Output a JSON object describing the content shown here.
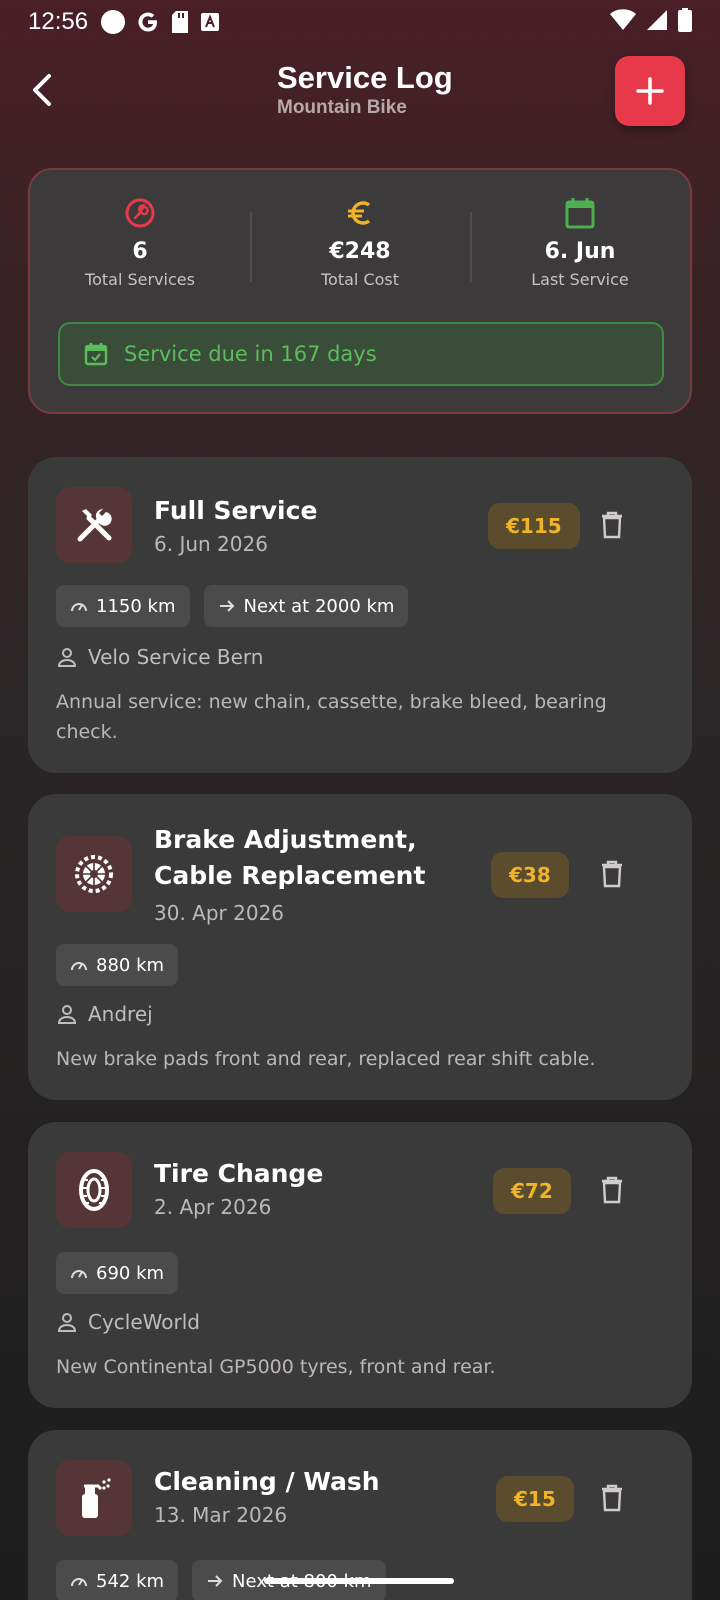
{
  "status_bar": {
    "time": "12:56"
  },
  "header": {
    "title": "Service Log",
    "subtitle": "Mountain Bike"
  },
  "summary": {
    "stats": [
      {
        "value": "6",
        "label": "Total Services",
        "icon": "wrench-icon",
        "color": "#e8394b"
      },
      {
        "value": "€248",
        "label": "Total Cost",
        "icon": "euro-icon",
        "color": "#f0b429"
      },
      {
        "value": "6. Jun",
        "label": "Last Service",
        "icon": "calendar-icon",
        "color": "#4caf50"
      }
    ],
    "due_text": "Service due in 167 days"
  },
  "services": [
    {
      "title": "Full Service",
      "date": "6. Jun 2026",
      "price": "€115",
      "icon": "tools-icon",
      "mileage": "1150 km",
      "next": "Next at 2000 km",
      "provider": "Velo Service Bern",
      "notes": "Annual service: new chain, cassette, brake bleed, bearing check."
    },
    {
      "title": "Brake Adjustment, Cable Replacement",
      "date": "30. Apr 2026",
      "price": "€38",
      "icon": "brake-disc-icon",
      "mileage": "880 km",
      "provider": "Andrej",
      "notes": "New brake pads front and rear, replaced rear shift cable."
    },
    {
      "title": "Tire Change",
      "date": "2. Apr 2026",
      "price": "€72",
      "icon": "tire-icon",
      "mileage": "690 km",
      "provider": "CycleWorld",
      "notes": "New Continental GP5000 tyres, front and rear."
    },
    {
      "title": "Cleaning / Wash",
      "date": "13. Mar 2026",
      "price": "€15",
      "icon": "spray-bottle-icon",
      "mileage": "542 km",
      "next": "Next at 800 km"
    }
  ]
}
